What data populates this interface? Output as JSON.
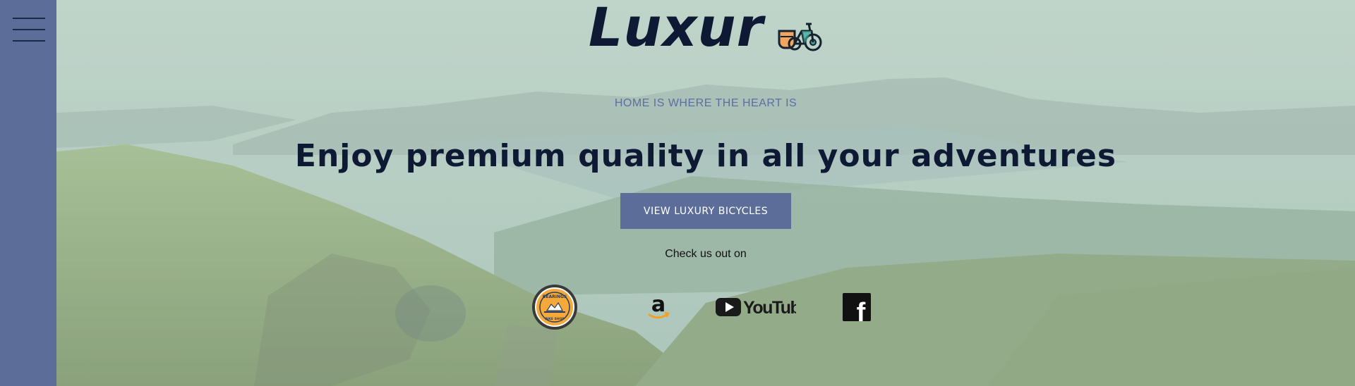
{
  "nav": {
    "menu_icon": "hamburger-menu-icon"
  },
  "header": {
    "brand": "Luxur",
    "brand_icon": "bicycle-icon"
  },
  "hero": {
    "tagline": "HOME IS WHERE THE HEART IS",
    "headline": "Enjoy premium quality in all your adventures",
    "cta_label": "VIEW LUXURY BICYCLES",
    "partners_intro": "Check us out on",
    "partners": [
      {
        "name": "Bearings Bike Shop",
        "icon": "bike-shop-badge-icon",
        "text_top": "BEARINGS",
        "text_bottom": "BIKE SHOP"
      },
      {
        "name": "Amazon",
        "icon": "amazon-icon",
        "text": "a"
      },
      {
        "name": "YouTube",
        "icon": "youtube-icon",
        "text": "YouTube"
      },
      {
        "name": "Facebook",
        "icon": "facebook-icon",
        "text": "f"
      }
    ]
  },
  "colors": {
    "sidebar": "#5c6d99",
    "button": "#5c6d99",
    "headline": "#0e1a33",
    "tagline": "#5a6fa3",
    "hero_overlay": "#b6d0c4"
  }
}
